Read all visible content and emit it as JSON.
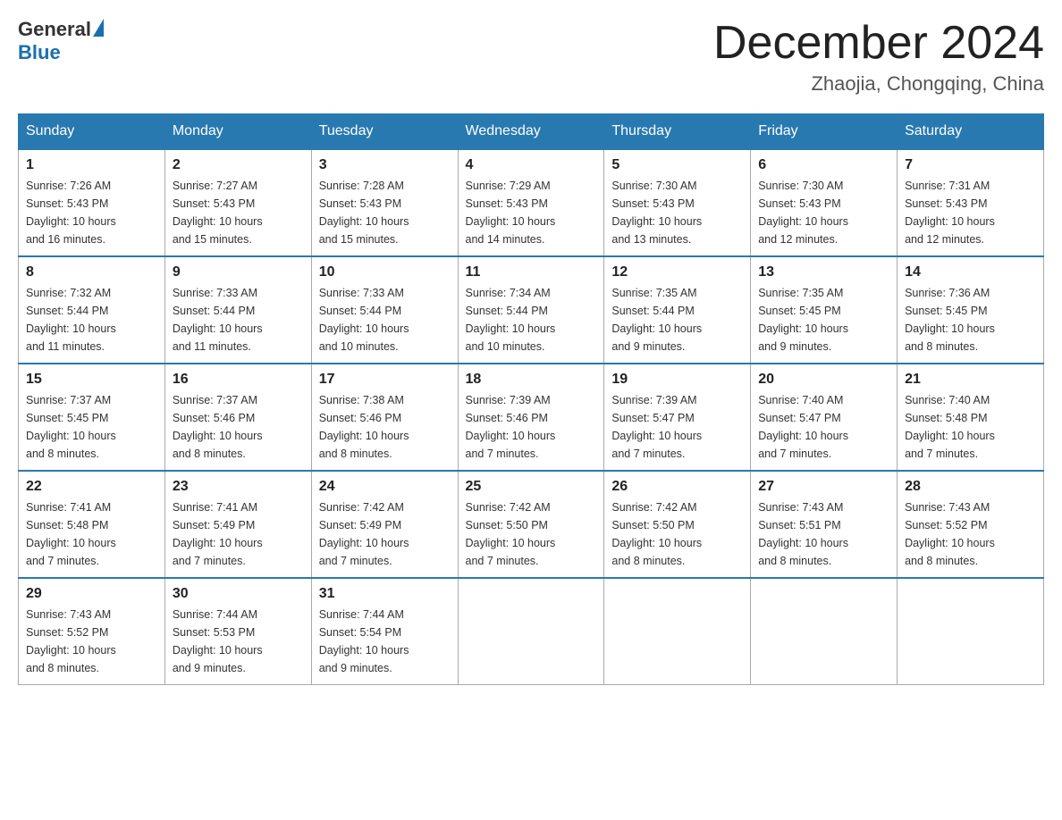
{
  "header": {
    "logo": {
      "general": "General",
      "blue": "Blue"
    },
    "title": "December 2024",
    "location": "Zhaojia, Chongqing, China"
  },
  "calendar": {
    "days_of_week": [
      "Sunday",
      "Monday",
      "Tuesday",
      "Wednesday",
      "Thursday",
      "Friday",
      "Saturday"
    ],
    "weeks": [
      [
        {
          "day": "1",
          "sunrise": "7:26 AM",
          "sunset": "5:43 PM",
          "daylight": "10 hours and 16 minutes."
        },
        {
          "day": "2",
          "sunrise": "7:27 AM",
          "sunset": "5:43 PM",
          "daylight": "10 hours and 15 minutes."
        },
        {
          "day": "3",
          "sunrise": "7:28 AM",
          "sunset": "5:43 PM",
          "daylight": "10 hours and 15 minutes."
        },
        {
          "day": "4",
          "sunrise": "7:29 AM",
          "sunset": "5:43 PM",
          "daylight": "10 hours and 14 minutes."
        },
        {
          "day": "5",
          "sunrise": "7:30 AM",
          "sunset": "5:43 PM",
          "daylight": "10 hours and 13 minutes."
        },
        {
          "day": "6",
          "sunrise": "7:30 AM",
          "sunset": "5:43 PM",
          "daylight": "10 hours and 12 minutes."
        },
        {
          "day": "7",
          "sunrise": "7:31 AM",
          "sunset": "5:43 PM",
          "daylight": "10 hours and 12 minutes."
        }
      ],
      [
        {
          "day": "8",
          "sunrise": "7:32 AM",
          "sunset": "5:44 PM",
          "daylight": "10 hours and 11 minutes."
        },
        {
          "day": "9",
          "sunrise": "7:33 AM",
          "sunset": "5:44 PM",
          "daylight": "10 hours and 11 minutes."
        },
        {
          "day": "10",
          "sunrise": "7:33 AM",
          "sunset": "5:44 PM",
          "daylight": "10 hours and 10 minutes."
        },
        {
          "day": "11",
          "sunrise": "7:34 AM",
          "sunset": "5:44 PM",
          "daylight": "10 hours and 10 minutes."
        },
        {
          "day": "12",
          "sunrise": "7:35 AM",
          "sunset": "5:44 PM",
          "daylight": "10 hours and 9 minutes."
        },
        {
          "day": "13",
          "sunrise": "7:35 AM",
          "sunset": "5:45 PM",
          "daylight": "10 hours and 9 minutes."
        },
        {
          "day": "14",
          "sunrise": "7:36 AM",
          "sunset": "5:45 PM",
          "daylight": "10 hours and 8 minutes."
        }
      ],
      [
        {
          "day": "15",
          "sunrise": "7:37 AM",
          "sunset": "5:45 PM",
          "daylight": "10 hours and 8 minutes."
        },
        {
          "day": "16",
          "sunrise": "7:37 AM",
          "sunset": "5:46 PM",
          "daylight": "10 hours and 8 minutes."
        },
        {
          "day": "17",
          "sunrise": "7:38 AM",
          "sunset": "5:46 PM",
          "daylight": "10 hours and 8 minutes."
        },
        {
          "day": "18",
          "sunrise": "7:39 AM",
          "sunset": "5:46 PM",
          "daylight": "10 hours and 7 minutes."
        },
        {
          "day": "19",
          "sunrise": "7:39 AM",
          "sunset": "5:47 PM",
          "daylight": "10 hours and 7 minutes."
        },
        {
          "day": "20",
          "sunrise": "7:40 AM",
          "sunset": "5:47 PM",
          "daylight": "10 hours and 7 minutes."
        },
        {
          "day": "21",
          "sunrise": "7:40 AM",
          "sunset": "5:48 PM",
          "daylight": "10 hours and 7 minutes."
        }
      ],
      [
        {
          "day": "22",
          "sunrise": "7:41 AM",
          "sunset": "5:48 PM",
          "daylight": "10 hours and 7 minutes."
        },
        {
          "day": "23",
          "sunrise": "7:41 AM",
          "sunset": "5:49 PM",
          "daylight": "10 hours and 7 minutes."
        },
        {
          "day": "24",
          "sunrise": "7:42 AM",
          "sunset": "5:49 PM",
          "daylight": "10 hours and 7 minutes."
        },
        {
          "day": "25",
          "sunrise": "7:42 AM",
          "sunset": "5:50 PM",
          "daylight": "10 hours and 7 minutes."
        },
        {
          "day": "26",
          "sunrise": "7:42 AM",
          "sunset": "5:50 PM",
          "daylight": "10 hours and 8 minutes."
        },
        {
          "day": "27",
          "sunrise": "7:43 AM",
          "sunset": "5:51 PM",
          "daylight": "10 hours and 8 minutes."
        },
        {
          "day": "28",
          "sunrise": "7:43 AM",
          "sunset": "5:52 PM",
          "daylight": "10 hours and 8 minutes."
        }
      ],
      [
        {
          "day": "29",
          "sunrise": "7:43 AM",
          "sunset": "5:52 PM",
          "daylight": "10 hours and 8 minutes."
        },
        {
          "day": "30",
          "sunrise": "7:44 AM",
          "sunset": "5:53 PM",
          "daylight": "10 hours and 9 minutes."
        },
        {
          "day": "31",
          "sunrise": "7:44 AM",
          "sunset": "5:54 PM",
          "daylight": "10 hours and 9 minutes."
        },
        null,
        null,
        null,
        null
      ]
    ],
    "labels": {
      "sunrise": "Sunrise:",
      "sunset": "Sunset:",
      "daylight": "Daylight:"
    }
  }
}
